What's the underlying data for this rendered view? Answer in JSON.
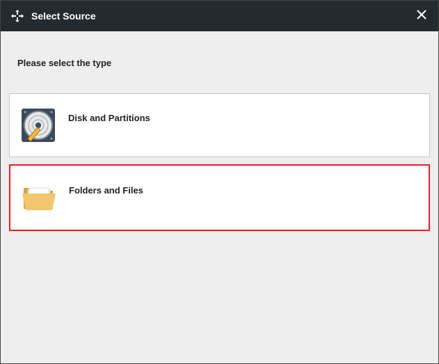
{
  "titlebar": {
    "title": "Select Source"
  },
  "content": {
    "prompt": "Please select the type"
  },
  "options": {
    "disk": {
      "label": "Disk and Partitions"
    },
    "folders": {
      "label": "Folders and Files"
    }
  }
}
